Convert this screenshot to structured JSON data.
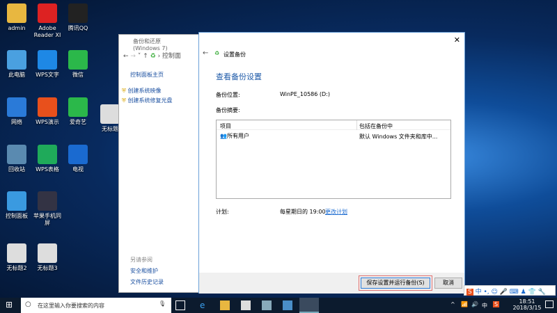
{
  "desktop": {
    "icons": [
      "admin",
      "Adobe Reader XI",
      "腾讯QQ",
      "此电脑",
      "WPS文字",
      "微信",
      "网络",
      "WPS演示",
      "爱奇艺",
      "无标题",
      "回收站",
      "WPS表格",
      "电视",
      "控制面板",
      "苹果手机同屏",
      "无标题2",
      "无标题3"
    ]
  },
  "backup_window": {
    "title": "备份和还原(Windows 7)",
    "breadcrumb": "控制面",
    "home": "控制面板主页",
    "links": [
      "创建系统映像",
      "创建系统修复光盘"
    ],
    "see_also": "另请参阅",
    "see_also_links": [
      "安全和维护",
      "文件历史记录"
    ]
  },
  "dialog": {
    "title": "设置备份",
    "heading": "查看备份设置",
    "location_label": "备份位置:",
    "location_value": "WinPE_10586 (D:)",
    "summary_label": "备份摘要:",
    "columns": [
      "项目",
      "包括在备份中"
    ],
    "rows": [
      {
        "item": "所有用户",
        "included": "默认 Windows 文件夹和库中..."
      }
    ],
    "schedule_label": "计划:",
    "schedule_value": "每星期日的 19:00",
    "change_schedule": "更改计划",
    "save_button": "保存设置并运行备份(S)",
    "cancel_button": "取消",
    "close": "✕"
  },
  "ime": {
    "lang": "中"
  },
  "taskbar": {
    "search_placeholder": "在这里输入你要搜索的内容",
    "lang": "中",
    "time": "18:51",
    "date": "2018/3/15"
  }
}
